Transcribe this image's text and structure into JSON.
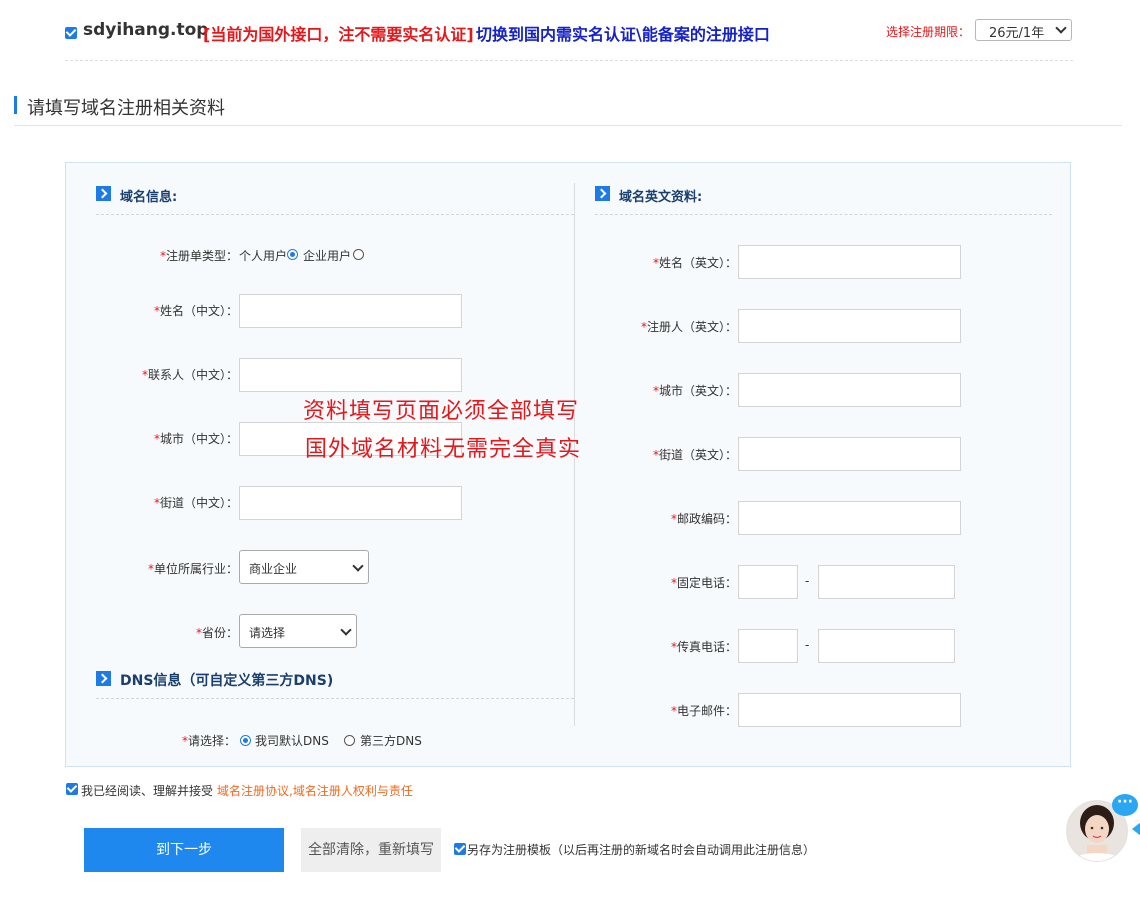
{
  "top": {
    "domain": "sdyihang.top",
    "note": "[当前为国外接口，注不需要实名认证]",
    "switch_link": "切换到国内需实名认证\\能备案的注册接口",
    "period_label": "选择注册期限：",
    "period_value": "26元/1年"
  },
  "section_title": "请填写域名注册相关资料",
  "cn_section": {
    "title": "域名信息:",
    "type_label": "*注册单类型：",
    "type_options": [
      "个人用户",
      "企业用户"
    ],
    "type_selected": "个人用户",
    "fields": [
      {
        "label": "*姓名（中文）："
      },
      {
        "label": "*联系人（中文）："
      },
      {
        "label": "*城市（中文）："
      },
      {
        "label": "*街道（中文）："
      }
    ],
    "industry_label": "*单位所属行业：",
    "industry_value": "商业企业",
    "province_label": "*省份：",
    "province_value": "请选择"
  },
  "dns_section": {
    "title": "DNS信息（可自定义第三方DNS)",
    "choose_label": "*请选择：",
    "options": [
      "我司默认DNS",
      "第三方DNS"
    ],
    "selected": "我司默认DNS"
  },
  "en_section": {
    "title": "域名英文资料:",
    "fields": [
      {
        "label": "*姓名（英文）："
      },
      {
        "label": "*注册人（英文）："
      },
      {
        "label": "*城市（英文）："
      },
      {
        "label": "*街道（英文）："
      },
      {
        "label": "*邮政编码："
      }
    ],
    "phone_label": "*固定电话：",
    "fax_label": "*传真电话：",
    "email_label": "*电子邮件：",
    "dash": "-"
  },
  "overlay": {
    "line1": "资料填写页面必须全部填写",
    "line2": "国外域名材料无需完全真实"
  },
  "agreement": {
    "text": "我已经阅读、理解并接受",
    "link": "域名注册协议,域名注册人权利与责任"
  },
  "buttons": {
    "next": "到下一步",
    "clear": "全部清除，重新填写"
  },
  "template_option": "另存为注册模板（以后再注册的新域名时会自动调用此注册信息）",
  "colors": {
    "accent": "#1e7be6",
    "warning": "#e6171b",
    "link": "#f26a22"
  }
}
